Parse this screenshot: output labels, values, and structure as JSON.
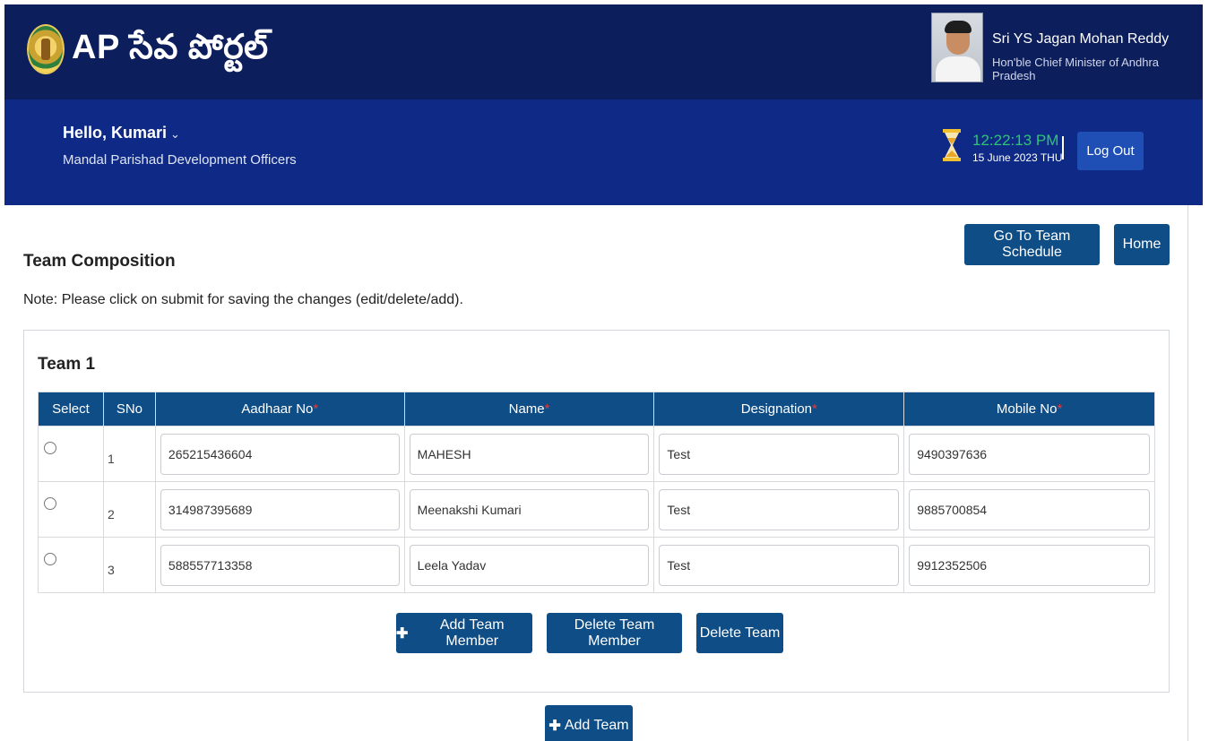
{
  "header": {
    "app_title": "AP సేవ పోర్టల్",
    "logo_icon": "ap-state-emblem",
    "cm_name": "Sri YS Jagan Mohan Reddy",
    "cm_role": "Hon'ble Chief Minister of Andhra Pradesh"
  },
  "user_bar": {
    "greeting": "Hello, Kumari",
    "chevron": "⌄",
    "role": "Mandal Parishad Development Officers",
    "time": "12:22:13 PM",
    "date": "15 June 2023 THU",
    "logout_label": "Log Out",
    "time_color": "#2ec473"
  },
  "toolbar": {
    "schedule_label": "Go To Team Schedule",
    "home_label": "Home"
  },
  "page": {
    "title": "Team Composition",
    "note": "Note: Please click on submit for saving the changes (edit/delete/add)."
  },
  "team": {
    "title": "Team 1",
    "columns": [
      "Select",
      "SNo",
      "Aadhaar No",
      "Name",
      "Designation",
      "Mobile No"
    ],
    "required_mark": "*",
    "rows": [
      {
        "sno": "1",
        "aadhaar": "265215436604",
        "name": "MAHESH",
        "designation": "Test",
        "mobile": "9490397636"
      },
      {
        "sno": "2",
        "aadhaar": "314987395689",
        "name": "Meenakshi Kumari",
        "designation": "Test",
        "mobile": "9885700854"
      },
      {
        "sno": "3",
        "aadhaar": "588557713358",
        "name": "Leela Yadav",
        "designation": "Test",
        "mobile": "9912352506"
      }
    ],
    "plus_glyph": "✚",
    "add_member_label": "Add Team Member",
    "delete_member_label": "Delete Team Member",
    "delete_team_label": "Delete Team"
  },
  "footer_actions": {
    "add_team_label": "Add Team"
  },
  "colors": {
    "header_dark": "#0c1e5b",
    "header_blue": "#0f2a86",
    "button": "#0f4d86",
    "required": "#e33b3b"
  }
}
